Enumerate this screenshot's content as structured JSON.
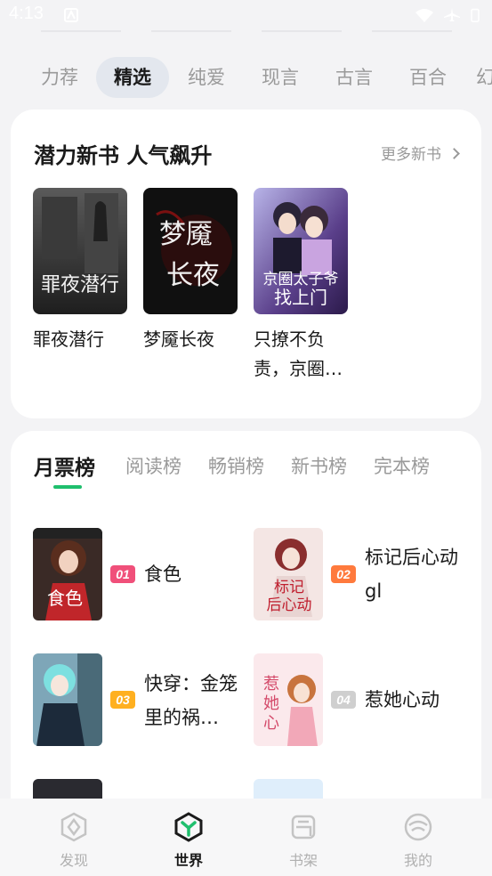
{
  "status_bar": {
    "time": "4:13"
  },
  "categories": [
    "力荐",
    "精选",
    "纯爱",
    "现言",
    "古言",
    "百合",
    "幻"
  ],
  "new_books": {
    "title": "潜力新书 人气飙升",
    "more_label": "更多新书",
    "books": [
      {
        "name": "罪夜潜行",
        "cover_text": "罪夜潜行"
      },
      {
        "name": "梦魇长夜",
        "cover_text": "梦魇长夜"
      },
      {
        "name": "只撩不负责，京圈…",
        "cover_text": "京圈太子爷找上门"
      }
    ]
  },
  "ranking": {
    "tabs": [
      "月票榜",
      "阅读榜",
      "畅销榜",
      "新书榜",
      "完本榜"
    ],
    "items": [
      {
        "rank": "01",
        "name": "食色",
        "rank_color": "#f0507a",
        "cover_text": "食色"
      },
      {
        "rank": "02",
        "name": "标记后心动gl",
        "rank_color": "#ff7a3d",
        "cover_text": "标记后心动"
      },
      {
        "rank": "03",
        "name": "快穿：金笼里的祸…",
        "rank_color": "#ffb020",
        "cover_text": ""
      },
      {
        "rank": "04",
        "name": "惹她心动",
        "rank_color": "#cfcfcf",
        "cover_text": "惹她心动"
      }
    ]
  },
  "bottom_nav": [
    {
      "label": "发现",
      "icon": "discover-icon"
    },
    {
      "label": "世界",
      "icon": "world-icon"
    },
    {
      "label": "书架",
      "icon": "bookshelf-icon"
    },
    {
      "label": "我的",
      "icon": "profile-icon"
    }
  ],
  "colors": {
    "accent": "#1fbf6d",
    "card_bg": "#ffffff",
    "page_bg": "#f3f3f5"
  }
}
